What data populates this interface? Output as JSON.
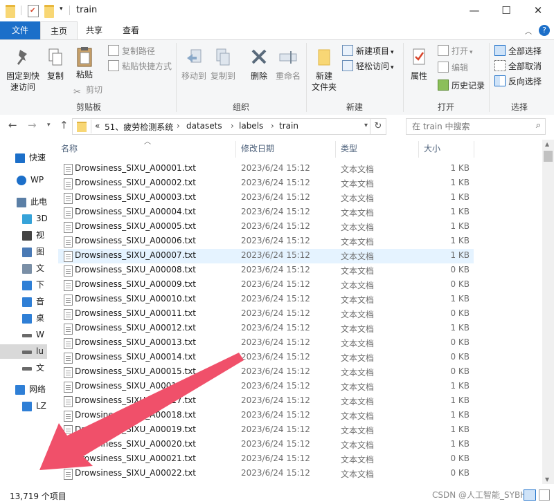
{
  "window": {
    "title": "train"
  },
  "ribbon_tabs": {
    "file": "文件",
    "home": "主页",
    "share": "共享",
    "view": "查看"
  },
  "ribbon": {
    "clipboard": {
      "label": "剪贴板",
      "pin": "固定到快\n速访问",
      "copy": "复制",
      "paste": "粘贴",
      "copy_path": "复制路径",
      "paste_shortcut": "粘贴快捷方式",
      "cut": "剪切"
    },
    "organize": {
      "label": "组织",
      "move_to": "移动到",
      "copy_to": "复制到",
      "delete": "删除",
      "rename": "重命名"
    },
    "new": {
      "label": "新建",
      "new_folder": "新建\n文件夹",
      "new_item": "新建项目",
      "easy_access": "轻松访问"
    },
    "open": {
      "label": "打开",
      "properties": "属性",
      "open": "打开",
      "edit": "编辑",
      "history": "历史记录"
    },
    "select": {
      "label": "选择",
      "select_all": "全部选择",
      "select_none": "全部取消",
      "invert": "反向选择"
    }
  },
  "address": {
    "overflow": "«",
    "crumbs": [
      "51、疲劳检测系统",
      "datasets",
      "labels",
      "train"
    ],
    "search_placeholder": "在 train 中搜索"
  },
  "nav": [
    {
      "label": "快速",
      "icon": "star-icon"
    },
    {
      "label": "WP",
      "icon": "cloud-icon"
    },
    {
      "label": "此电",
      "icon": "computer-icon"
    },
    {
      "label": "3D",
      "icon": "cube-icon"
    },
    {
      "label": "视",
      "icon": "video-icon"
    },
    {
      "label": "图",
      "icon": "picture-icon"
    },
    {
      "label": "文",
      "icon": "document-icon"
    },
    {
      "label": "下",
      "icon": "download-icon"
    },
    {
      "label": "音",
      "icon": "music-icon"
    },
    {
      "label": "桌",
      "icon": "desktop-icon"
    },
    {
      "label": "W",
      "icon": "drive-icon"
    },
    {
      "label": "lu",
      "icon": "drive-icon"
    },
    {
      "label": "文",
      "icon": "drive-icon"
    },
    {
      "label": "网络",
      "icon": "network-icon"
    },
    {
      "label": "LZ",
      "icon": "monitor-icon"
    }
  ],
  "columns": {
    "name": "名称",
    "date": "修改日期",
    "type": "类型",
    "size": "大小"
  },
  "files": [
    {
      "name": "Drowsiness_SIXU_A00001.txt",
      "date": "2023/6/24 15:12",
      "type": "文本文档",
      "size": "1 KB"
    },
    {
      "name": "Drowsiness_SIXU_A00002.txt",
      "date": "2023/6/24 15:12",
      "type": "文本文档",
      "size": "1 KB"
    },
    {
      "name": "Drowsiness_SIXU_A00003.txt",
      "date": "2023/6/24 15:12",
      "type": "文本文档",
      "size": "1 KB"
    },
    {
      "name": "Drowsiness_SIXU_A00004.txt",
      "date": "2023/6/24 15:12",
      "type": "文本文档",
      "size": "1 KB"
    },
    {
      "name": "Drowsiness_SIXU_A00005.txt",
      "date": "2023/6/24 15:12",
      "type": "文本文档",
      "size": "1 KB"
    },
    {
      "name": "Drowsiness_SIXU_A00006.txt",
      "date": "2023/6/24 15:12",
      "type": "文本文档",
      "size": "1 KB"
    },
    {
      "name": "Drowsiness_SIXU_A00007.txt",
      "date": "2023/6/24 15:12",
      "type": "文本文档",
      "size": "1 KB"
    },
    {
      "name": "Drowsiness_SIXU_A00008.txt",
      "date": "2023/6/24 15:12",
      "type": "文本文档",
      "size": "0 KB"
    },
    {
      "name": "Drowsiness_SIXU_A00009.txt",
      "date": "2023/6/24 15:12",
      "type": "文本文档",
      "size": "0 KB"
    },
    {
      "name": "Drowsiness_SIXU_A00010.txt",
      "date": "2023/6/24 15:12",
      "type": "文本文档",
      "size": "1 KB"
    },
    {
      "name": "Drowsiness_SIXU_A00011.txt",
      "date": "2023/6/24 15:12",
      "type": "文本文档",
      "size": "0 KB"
    },
    {
      "name": "Drowsiness_SIXU_A00012.txt",
      "date": "2023/6/24 15:12",
      "type": "文本文档",
      "size": "1 KB"
    },
    {
      "name": "Drowsiness_SIXU_A00013.txt",
      "date": "2023/6/24 15:12",
      "type": "文本文档",
      "size": "0 KB"
    },
    {
      "name": "Drowsiness_SIXU_A00014.txt",
      "date": "2023/6/24 15:12",
      "type": "文本文档",
      "size": "0 KB"
    },
    {
      "name": "Drowsiness_SIXU_A00015.txt",
      "date": "2023/6/24 15:12",
      "type": "文本文档",
      "size": "0 KB"
    },
    {
      "name": "Drowsiness_SIXU_A00016.txt",
      "date": "2023/6/24 15:12",
      "type": "文本文档",
      "size": "1 KB"
    },
    {
      "name": "Drowsiness_SIXU_A00017.txt",
      "date": "2023/6/24 15:12",
      "type": "文本文档",
      "size": "1 KB"
    },
    {
      "name": "Drowsiness_SIXU_A00018.txt",
      "date": "2023/6/24 15:12",
      "type": "文本文档",
      "size": "1 KB"
    },
    {
      "name": "Drowsiness_SIXU_A00019.txt",
      "date": "2023/6/24 15:12",
      "type": "文本文档",
      "size": "1 KB"
    },
    {
      "name": "Drowsiness_SIXU_A00020.txt",
      "date": "2023/6/24 15:12",
      "type": "文本文档",
      "size": "1 KB"
    },
    {
      "name": "Drowsiness_SIXU_A00021.txt",
      "date": "2023/6/24 15:12",
      "type": "文本文档",
      "size": "0 KB"
    },
    {
      "name": "Drowsiness_SIXU_A00022.txt",
      "date": "2023/6/24 15:12",
      "type": "文本文档",
      "size": "0 KB"
    }
  ],
  "selected_row": 6,
  "status": {
    "count": "13,719 个项目"
  },
  "watermark": "CSDN @人工智能_SYBH",
  "colors": {
    "accent": "#1c6fc9",
    "selection": "#e5f3ff",
    "arrow": "#f0506a"
  }
}
